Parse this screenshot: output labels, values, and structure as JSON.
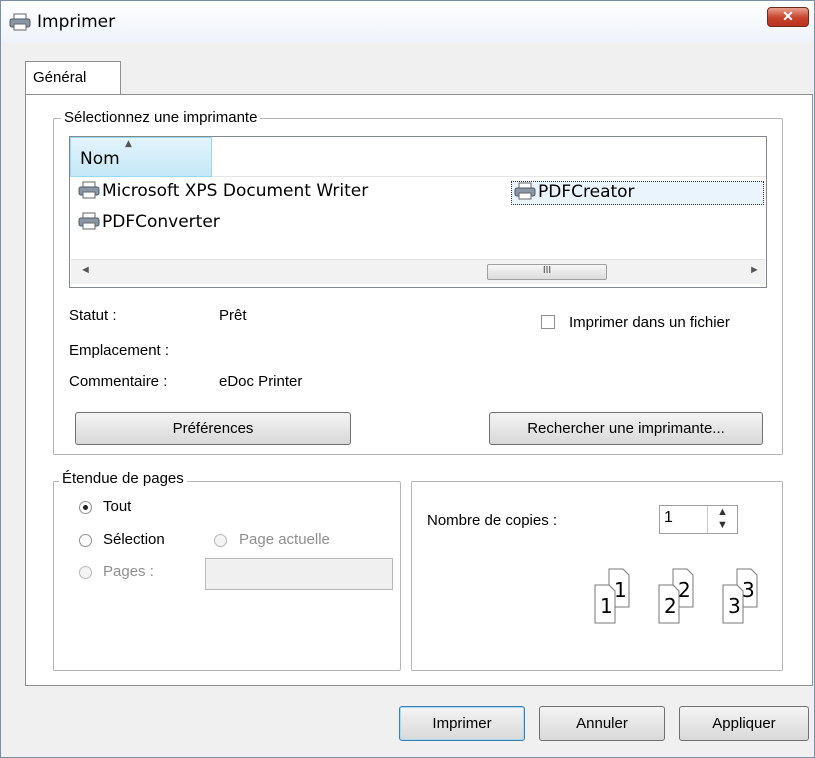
{
  "window": {
    "title": "Imprimer",
    "close": "✕"
  },
  "tabs": [
    {
      "label": "Général"
    }
  ],
  "printer_group": {
    "legend": "Sélectionnez une imprimante",
    "column_header": "Nom",
    "printers": [
      {
        "name": "Microsoft XPS Document Writer",
        "selected": false
      },
      {
        "name": "PDFCreator",
        "selected": true
      },
      {
        "name": "PDFConverter",
        "selected": false
      }
    ],
    "scroll_thumb": "III",
    "status_label": "Statut :",
    "status_value": "Prêt",
    "location_label": "Emplacement :",
    "location_value": "",
    "comment_label": "Commentaire :",
    "comment_value": "eDoc Printer",
    "print_to_file": {
      "label": "Imprimer dans un fichier",
      "checked": false
    },
    "preferences_button": "Préférences",
    "find_printer_button": "Rechercher une imprimante..."
  },
  "page_range": {
    "legend": "Étendue de pages",
    "options": [
      {
        "label": "Tout",
        "checked": true,
        "enabled": true
      },
      {
        "label": "Sélection",
        "checked": false,
        "enabled": true
      },
      {
        "label": "Page actuelle",
        "checked": false,
        "enabled": false
      },
      {
        "label": "Pages :",
        "checked": false,
        "enabled": false
      }
    ],
    "pages_value": ""
  },
  "copies": {
    "label": "Nombre de copies :",
    "value": "1",
    "collate_preview": [
      "1",
      "1",
      "2",
      "2",
      "3",
      "3"
    ]
  },
  "buttons": {
    "print": "Imprimer",
    "cancel": "Annuler",
    "apply": "Appliquer"
  }
}
